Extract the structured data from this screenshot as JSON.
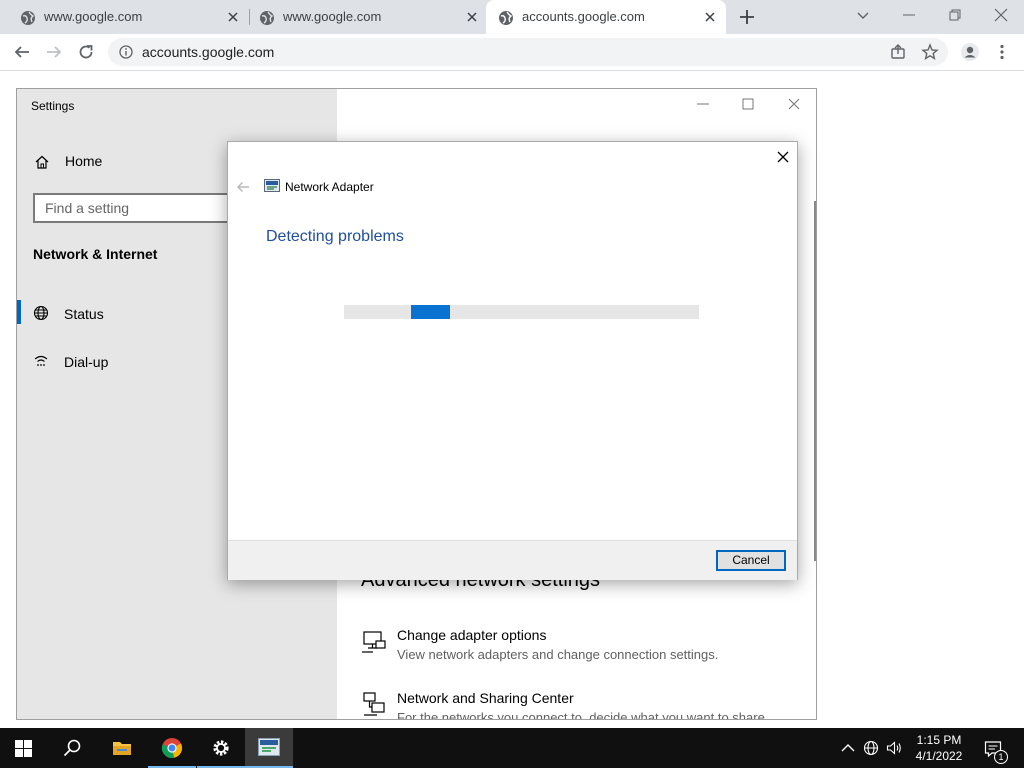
{
  "browser": {
    "tabs": [
      {
        "title": "www.google.com",
        "active": false
      },
      {
        "title": "www.google.com",
        "active": false
      },
      {
        "title": "accounts.google.com",
        "active": true
      }
    ],
    "address": "accounts.google.com",
    "icons": {
      "back": "arrow-left-icon",
      "forward": "arrow-right-icon",
      "reload": "reload-icon",
      "site_info": "info-icon",
      "share": "share-icon",
      "bookmark": "star-icon",
      "profile": "profile-icon",
      "menu": "kebab-menu-icon"
    }
  },
  "settings": {
    "title": "Settings",
    "home": "Home",
    "search_placeholder": "Find a setting",
    "section": "Network & Internet",
    "nav": [
      {
        "label": "Status",
        "icon": "globe-icon",
        "selected": true
      },
      {
        "label": "Dial-up",
        "icon": "dialup-icon",
        "selected": false
      }
    ],
    "advanced_heading": "Advanced network settings",
    "options": [
      {
        "title": "Change adapter options",
        "desc": "View network adapters and change connection settings.",
        "icon": "monitor-network-icon"
      },
      {
        "title": "Network and Sharing Center",
        "desc": "For the networks you connect to, decide what you want to share.",
        "icon": "network-sharing-icon"
      }
    ]
  },
  "dialog": {
    "title": "Network Adapter",
    "heading": "Detecting problems",
    "progress": {
      "indeterminate": true,
      "segment_start": 0.19,
      "segment_width": 0.11
    },
    "cancel": "Cancel"
  },
  "taskbar": {
    "apps": [
      "windows-start-icon",
      "search-icon",
      "file-explorer-icon",
      "chrome-icon",
      "settings-gear-icon",
      "troubleshooter-icon"
    ],
    "time": "1:15 PM",
    "date": "4/1/2022",
    "notifications": "1"
  },
  "colors": {
    "chrome_tabstrip": "#dee1e6",
    "settings_sidebar": "#e6e6e6",
    "accent": "#0067c0",
    "dialog_heading": "#1f4e9c",
    "progress_fill": "#0a73d1",
    "taskbar": "#101010"
  }
}
